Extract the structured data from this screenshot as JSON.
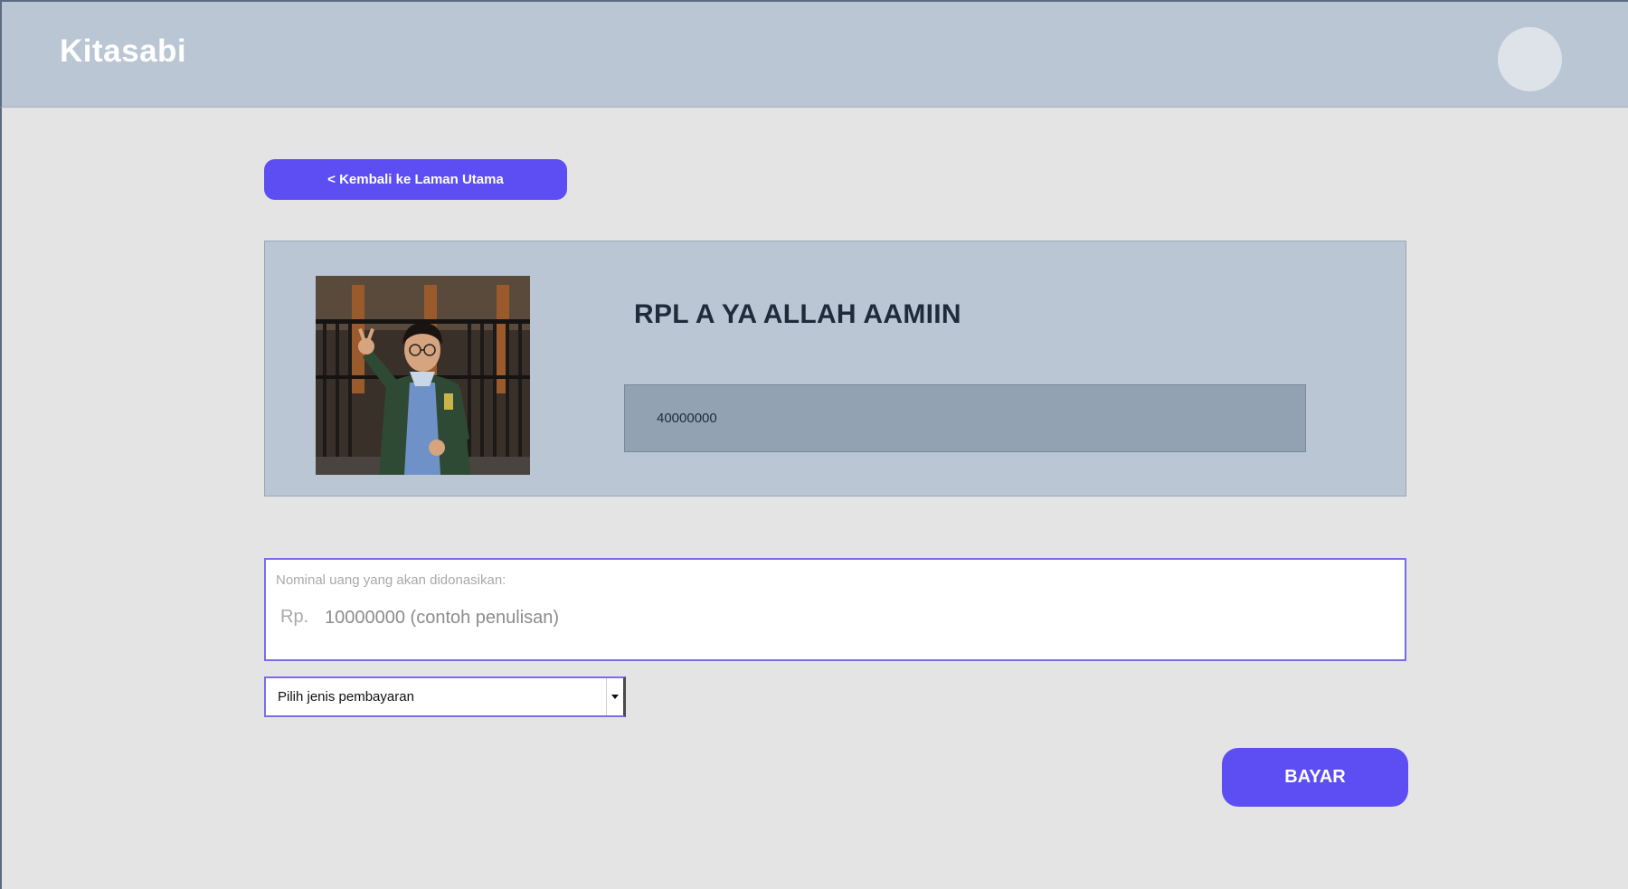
{
  "header": {
    "brand": "Kitasabi",
    "avatar_icon": "user-avatar-icon"
  },
  "nav": {
    "back_label": "< Kembali ke Laman Utama"
  },
  "campaign": {
    "title": "RPL A YA ALLAH AAMIIN",
    "target_value": "40000000",
    "photo_icon": "campaign-photo"
  },
  "donation": {
    "label": "Nominal uang yang akan didonasikan:",
    "currency": "Rp.",
    "placeholder": "10000000 (contoh penulisan)",
    "value": ""
  },
  "payment": {
    "selected": "Pilih jenis pembayaran"
  },
  "actions": {
    "pay_label": "BAYAR"
  },
  "colors": {
    "header_bg": "#bac6d3",
    "accent": "#5c4ef2",
    "page_bg": "#e4e4e4",
    "target_box": "#93a2b2"
  }
}
